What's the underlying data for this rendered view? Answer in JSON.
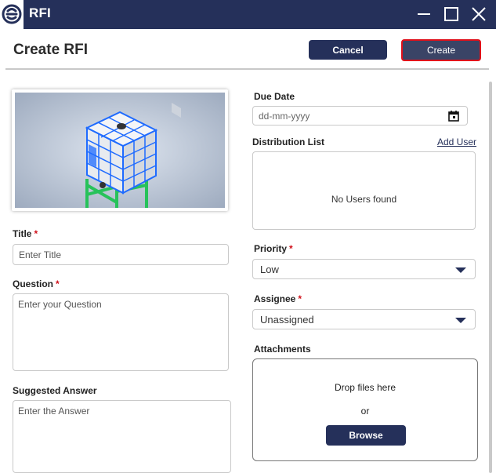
{
  "window": {
    "title": "RFI",
    "controls": [
      "minimize",
      "maximize",
      "close"
    ]
  },
  "header": {
    "title": "Create RFI",
    "cancel_label": "Cancel",
    "create_label": "Create"
  },
  "form": {
    "preview_image": "water-tank-on-stand",
    "title": {
      "label": "Title",
      "required_mark": "*",
      "placeholder": "Enter Title",
      "value": ""
    },
    "question": {
      "label": "Question",
      "required_mark": "*",
      "placeholder": "Enter your Question",
      "value": ""
    },
    "suggested_answer": {
      "label": "Suggested Answer",
      "placeholder": "Enter the Answer",
      "value": ""
    },
    "due_date": {
      "label": "Due Date",
      "placeholder": "dd-mm-yyyy",
      "icon": "calendar-icon"
    },
    "distribution_list": {
      "label": "Distribution List",
      "add_user_label": "Add User",
      "empty_text": "No Users found"
    },
    "priority": {
      "label": "Priority",
      "required_mark": "*",
      "selected": "Low"
    },
    "assignee": {
      "label": "Assignee",
      "required_mark": "*",
      "selected": "Unassigned"
    },
    "attachments": {
      "label": "Attachments",
      "drop_text": "Drop files here",
      "or_text": "or",
      "browse_label": "Browse"
    }
  },
  "colors": {
    "titlebar": "#25305a",
    "primary_button": "#25305a",
    "required": "#d0101a",
    "focus_outline": "#e0101a"
  }
}
